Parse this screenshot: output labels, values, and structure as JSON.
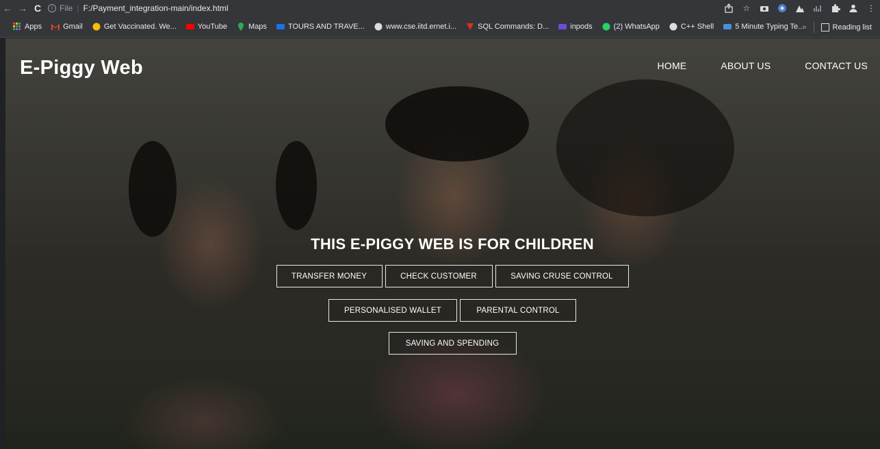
{
  "browser": {
    "url_scheme": "File",
    "url": "F:/Payment_integration-main/index.html",
    "bookmarks": [
      {
        "label": "Apps",
        "icon": "apps-grid-icon",
        "color": "#4285f4"
      },
      {
        "label": "Gmail",
        "icon": "gmail-icon",
        "color": "#ea4335"
      },
      {
        "label": "Get Vaccinated. We...",
        "icon": "google-icon",
        "color": "#fbbc05"
      },
      {
        "label": "YouTube",
        "icon": "youtube-icon",
        "color": "#ff0000"
      },
      {
        "label": "Maps",
        "icon": "maps-icon",
        "color": "#34a853"
      },
      {
        "label": "TOURS AND TRAVE...",
        "icon": "tours-icon",
        "color": "#1a73e8"
      },
      {
        "label": "www.cse.iitd.ernet.i...",
        "icon": "globe-icon",
        "color": "#dadce0"
      },
      {
        "label": "SQL Commands: D...",
        "icon": "sql-icon",
        "color": "#d93025"
      },
      {
        "label": "inpods",
        "icon": "inpods-icon",
        "color": "#6c4cdb"
      },
      {
        "label": "(2) WhatsApp",
        "icon": "whatsapp-icon",
        "color": "#25d366"
      },
      {
        "label": "C++ Shell",
        "icon": "globe-icon",
        "color": "#dadce0"
      },
      {
        "label": "5 Minute Typing Te...",
        "icon": "typing-icon",
        "color": "#4a90d9"
      }
    ],
    "reading_list": "Reading list"
  },
  "site": {
    "logo": "E-Piggy Web",
    "nav": [
      "HOME",
      "ABOUT US",
      "CONTACT US"
    ],
    "headline": "THIS E-PIGGY WEB IS FOR CHILDREN",
    "button_rows": [
      [
        "TRANSFER MONEY",
        "CHECK CUSTOMER",
        "SAVING CRUSE CONTROL"
      ],
      [
        "PERSONALISED WALLET",
        "PARENTAL CONTROL"
      ],
      [
        "SAVING AND SPENDING"
      ]
    ]
  }
}
